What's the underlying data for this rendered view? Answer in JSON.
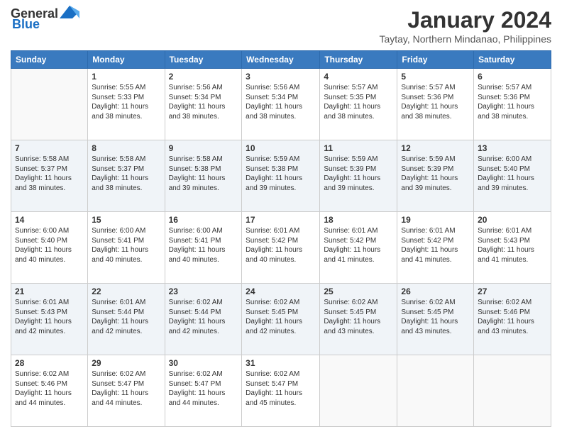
{
  "logo": {
    "line1": "General",
    "line2": "Blue"
  },
  "header": {
    "month": "January 2024",
    "location": "Taytay, Northern Mindanao, Philippines"
  },
  "days_of_week": [
    "Sunday",
    "Monday",
    "Tuesday",
    "Wednesday",
    "Thursday",
    "Friday",
    "Saturday"
  ],
  "weeks": [
    [
      {
        "day": "",
        "info": ""
      },
      {
        "day": "1",
        "info": "Sunrise: 5:55 AM\nSunset: 5:33 PM\nDaylight: 11 hours\nand 38 minutes."
      },
      {
        "day": "2",
        "info": "Sunrise: 5:56 AM\nSunset: 5:34 PM\nDaylight: 11 hours\nand 38 minutes."
      },
      {
        "day": "3",
        "info": "Sunrise: 5:56 AM\nSunset: 5:34 PM\nDaylight: 11 hours\nand 38 minutes."
      },
      {
        "day": "4",
        "info": "Sunrise: 5:57 AM\nSunset: 5:35 PM\nDaylight: 11 hours\nand 38 minutes."
      },
      {
        "day": "5",
        "info": "Sunrise: 5:57 AM\nSunset: 5:36 PM\nDaylight: 11 hours\nand 38 minutes."
      },
      {
        "day": "6",
        "info": "Sunrise: 5:57 AM\nSunset: 5:36 PM\nDaylight: 11 hours\nand 38 minutes."
      }
    ],
    [
      {
        "day": "7",
        "info": "Sunrise: 5:58 AM\nSunset: 5:37 PM\nDaylight: 11 hours\nand 38 minutes."
      },
      {
        "day": "8",
        "info": "Sunrise: 5:58 AM\nSunset: 5:37 PM\nDaylight: 11 hours\nand 38 minutes."
      },
      {
        "day": "9",
        "info": "Sunrise: 5:58 AM\nSunset: 5:38 PM\nDaylight: 11 hours\nand 39 minutes."
      },
      {
        "day": "10",
        "info": "Sunrise: 5:59 AM\nSunset: 5:38 PM\nDaylight: 11 hours\nand 39 minutes."
      },
      {
        "day": "11",
        "info": "Sunrise: 5:59 AM\nSunset: 5:39 PM\nDaylight: 11 hours\nand 39 minutes."
      },
      {
        "day": "12",
        "info": "Sunrise: 5:59 AM\nSunset: 5:39 PM\nDaylight: 11 hours\nand 39 minutes."
      },
      {
        "day": "13",
        "info": "Sunrise: 6:00 AM\nSunset: 5:40 PM\nDaylight: 11 hours\nand 39 minutes."
      }
    ],
    [
      {
        "day": "14",
        "info": "Sunrise: 6:00 AM\nSunset: 5:40 PM\nDaylight: 11 hours\nand 40 minutes."
      },
      {
        "day": "15",
        "info": "Sunrise: 6:00 AM\nSunset: 5:41 PM\nDaylight: 11 hours\nand 40 minutes."
      },
      {
        "day": "16",
        "info": "Sunrise: 6:00 AM\nSunset: 5:41 PM\nDaylight: 11 hours\nand 40 minutes."
      },
      {
        "day": "17",
        "info": "Sunrise: 6:01 AM\nSunset: 5:42 PM\nDaylight: 11 hours\nand 40 minutes."
      },
      {
        "day": "18",
        "info": "Sunrise: 6:01 AM\nSunset: 5:42 PM\nDaylight: 11 hours\nand 41 minutes."
      },
      {
        "day": "19",
        "info": "Sunrise: 6:01 AM\nSunset: 5:42 PM\nDaylight: 11 hours\nand 41 minutes."
      },
      {
        "day": "20",
        "info": "Sunrise: 6:01 AM\nSunset: 5:43 PM\nDaylight: 11 hours\nand 41 minutes."
      }
    ],
    [
      {
        "day": "21",
        "info": "Sunrise: 6:01 AM\nSunset: 5:43 PM\nDaylight: 11 hours\nand 42 minutes."
      },
      {
        "day": "22",
        "info": "Sunrise: 6:01 AM\nSunset: 5:44 PM\nDaylight: 11 hours\nand 42 minutes."
      },
      {
        "day": "23",
        "info": "Sunrise: 6:02 AM\nSunset: 5:44 PM\nDaylight: 11 hours\nand 42 minutes."
      },
      {
        "day": "24",
        "info": "Sunrise: 6:02 AM\nSunset: 5:45 PM\nDaylight: 11 hours\nand 42 minutes."
      },
      {
        "day": "25",
        "info": "Sunrise: 6:02 AM\nSunset: 5:45 PM\nDaylight: 11 hours\nand 43 minutes."
      },
      {
        "day": "26",
        "info": "Sunrise: 6:02 AM\nSunset: 5:45 PM\nDaylight: 11 hours\nand 43 minutes."
      },
      {
        "day": "27",
        "info": "Sunrise: 6:02 AM\nSunset: 5:46 PM\nDaylight: 11 hours\nand 43 minutes."
      }
    ],
    [
      {
        "day": "28",
        "info": "Sunrise: 6:02 AM\nSunset: 5:46 PM\nDaylight: 11 hours\nand 44 minutes."
      },
      {
        "day": "29",
        "info": "Sunrise: 6:02 AM\nSunset: 5:47 PM\nDaylight: 11 hours\nand 44 minutes."
      },
      {
        "day": "30",
        "info": "Sunrise: 6:02 AM\nSunset: 5:47 PM\nDaylight: 11 hours\nand 44 minutes."
      },
      {
        "day": "31",
        "info": "Sunrise: 6:02 AM\nSunset: 5:47 PM\nDaylight: 11 hours\nand 45 minutes."
      },
      {
        "day": "",
        "info": ""
      },
      {
        "day": "",
        "info": ""
      },
      {
        "day": "",
        "info": ""
      }
    ]
  ]
}
